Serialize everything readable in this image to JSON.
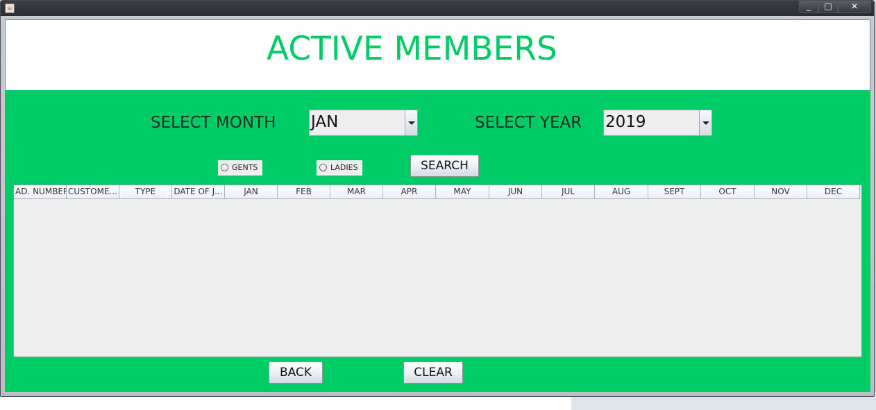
{
  "window": {
    "controls": {
      "minimize": "_",
      "maximize": "□",
      "close": "✕"
    }
  },
  "page": {
    "title": "ACTIVE MEMBERS"
  },
  "filters": {
    "month_label": "SELECT MONTH",
    "month_value": "JAN",
    "year_label": "SELECT YEAR",
    "year_value": "2019",
    "gents_label": "GENTS",
    "ladies_label": "LADIES",
    "search_label": "SEARCH"
  },
  "table": {
    "columns": [
      "AD. NUMBER",
      "CUSTOME...",
      "TYPE",
      "DATE OF J...",
      "JAN",
      "FEB",
      "MAR",
      "APR",
      "MAY",
      "JUN",
      "JUL",
      "AUG",
      "SEPT",
      "OCT",
      "NOV",
      "DEC"
    ],
    "rows": []
  },
  "footer": {
    "back_label": "BACK",
    "clear_label": "CLEAR"
  },
  "colors": {
    "accent": "#00cc66",
    "panel": "#eeeeee"
  },
  "icons": {
    "app": "java-icon",
    "combo_arrow": "chevron-down-icon"
  }
}
